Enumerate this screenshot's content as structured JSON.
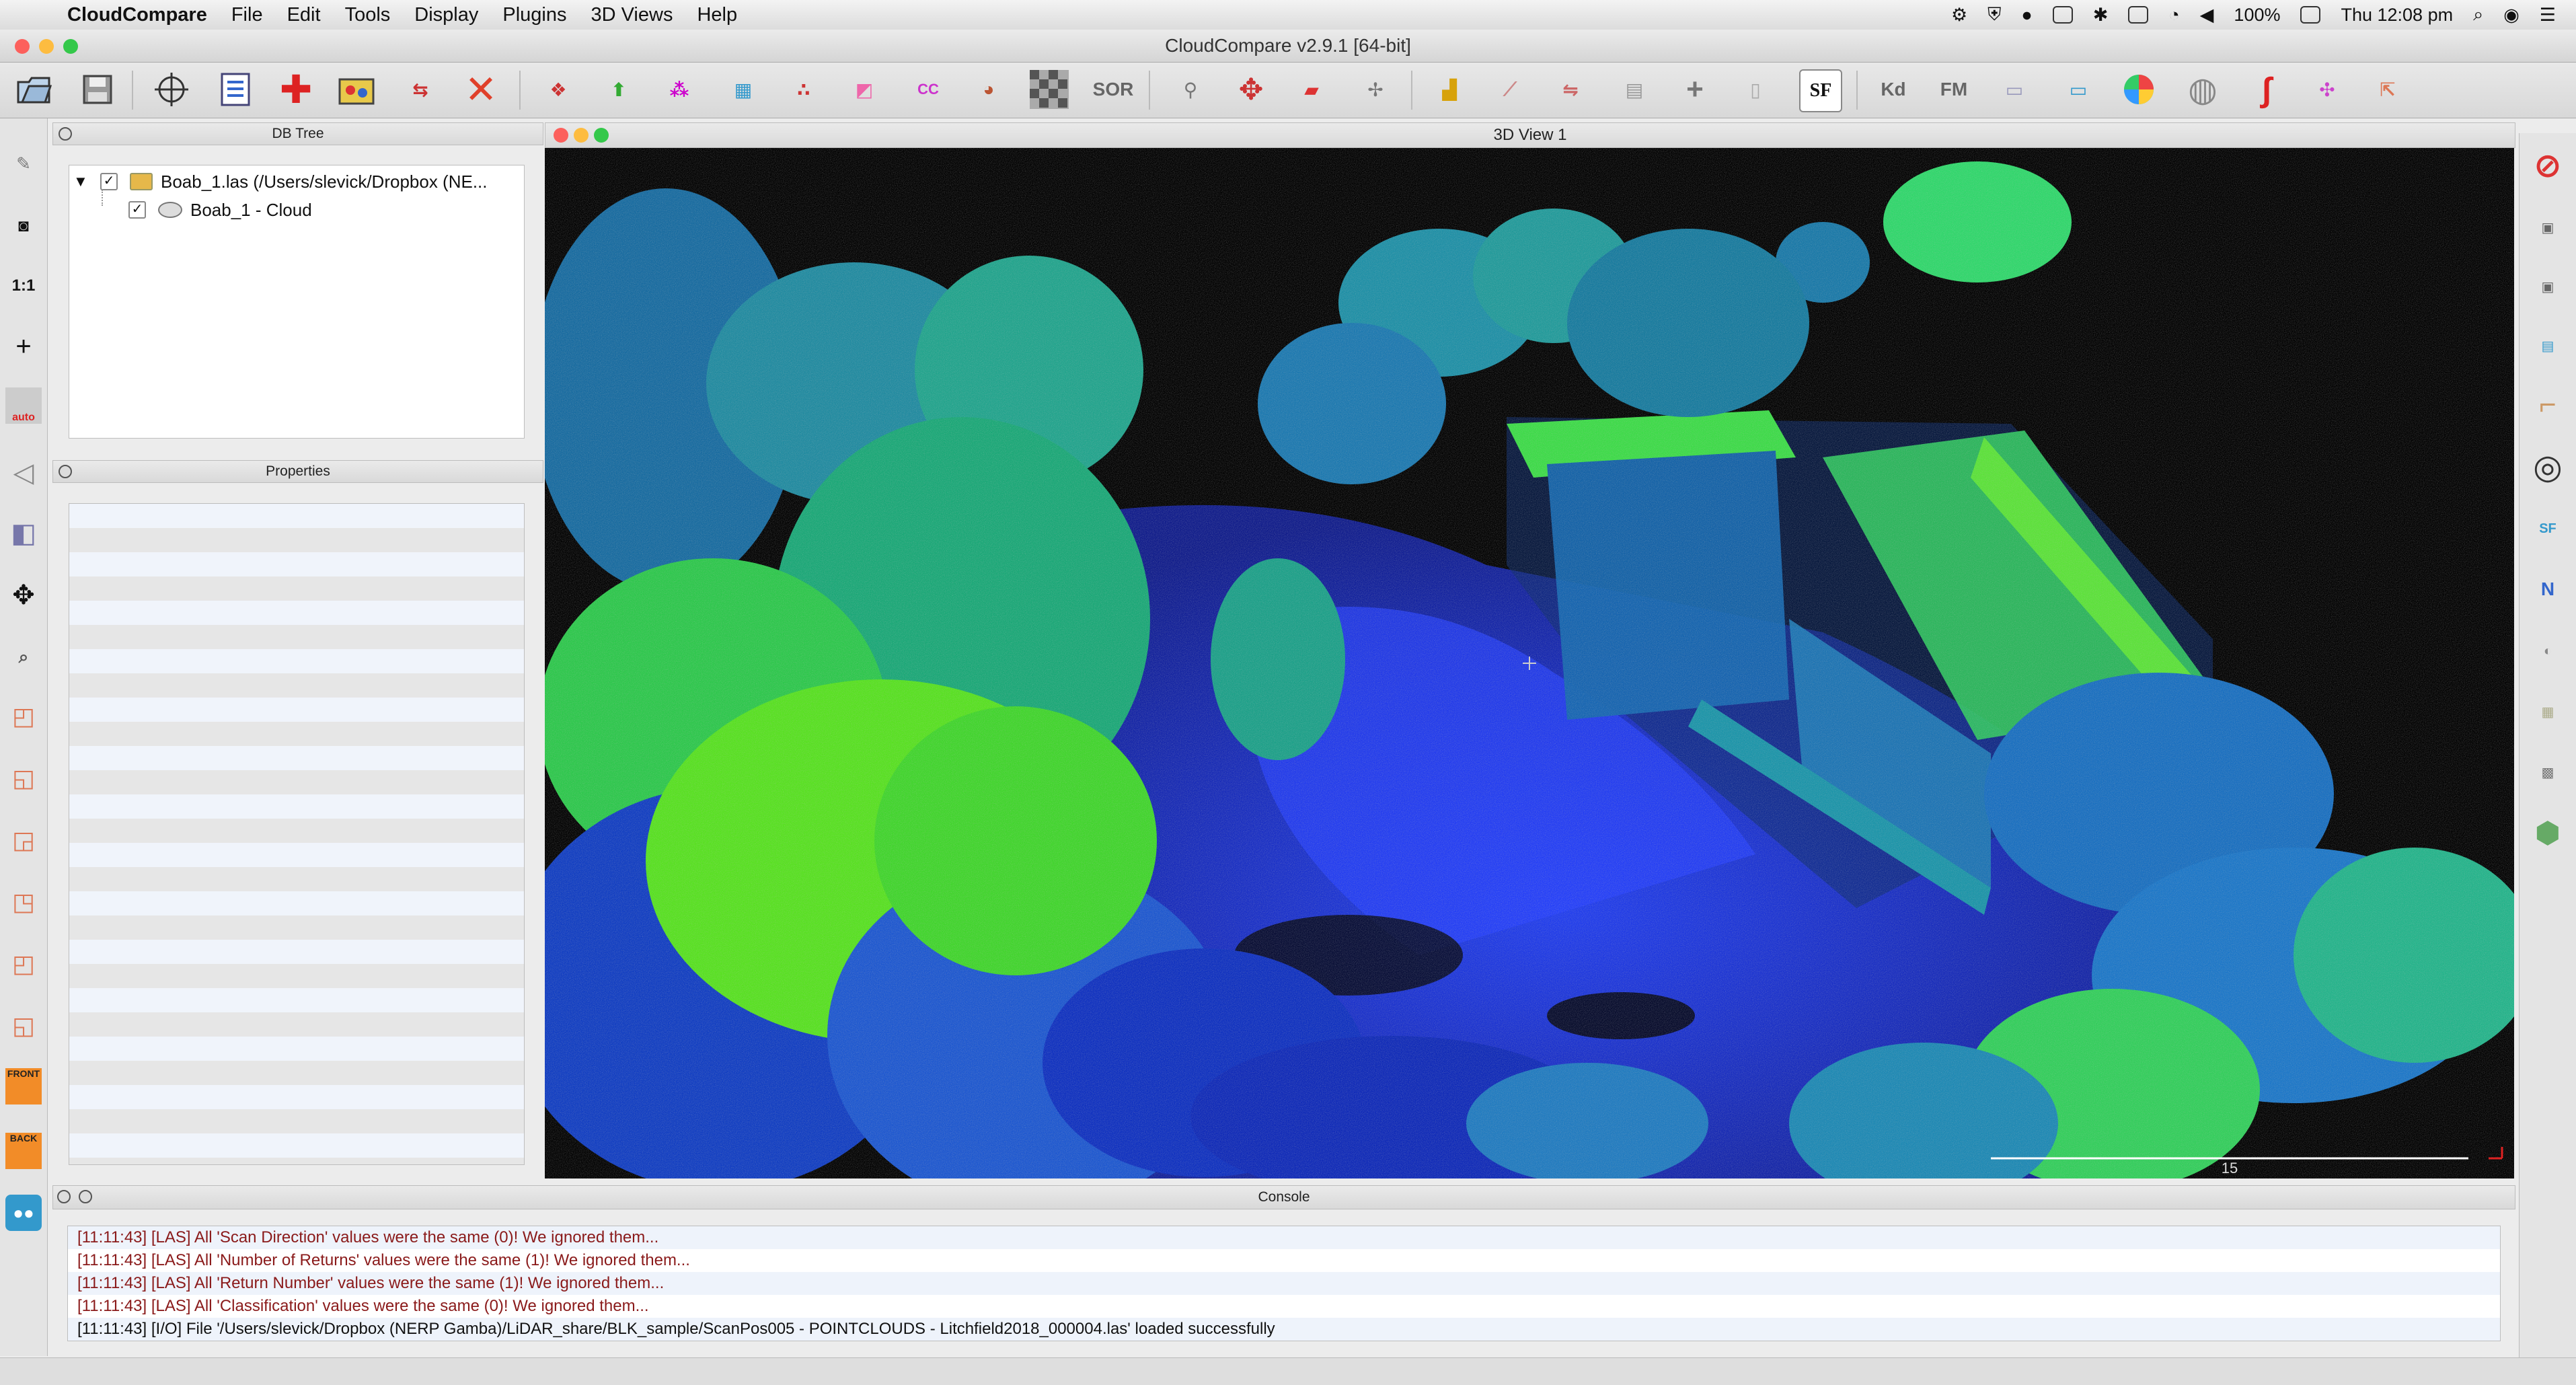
{
  "menubar": {
    "app_name": "CloudCompare",
    "items": [
      "File",
      "Edit",
      "Tools",
      "Display",
      "Plugins",
      "3D Views",
      "Help"
    ],
    "battery": "100%",
    "clock": "Thu 12:08 pm"
  },
  "window": {
    "title": "CloudCompare v2.9.1 [64-bit]"
  },
  "toolbar": {
    "sor_label": "SOR",
    "sf_label": "SF",
    "kd_label": "Kd",
    "fm_label": "FM",
    "cc_label": "CC"
  },
  "left_toolbar": {
    "scale_label": "1:1",
    "auto_label": "auto",
    "front_label": "FRONT",
    "back_label": "BACK"
  },
  "db_tree": {
    "header": "DB Tree",
    "root": {
      "label": "Boab_1.las (/Users/slevick/Dropbox (NE...",
      "checked": true
    },
    "child": {
      "label": "Boab_1 - Cloud",
      "checked": true
    }
  },
  "properties": {
    "header": "Properties"
  },
  "view3d": {
    "header": "3D View 1",
    "scale_value": "15",
    "colors": {
      "ground": "#1a2fc8",
      "mid": "#1e8ccc",
      "high": "#7cf21a",
      "background": "#000000"
    }
  },
  "right_toolbar": {
    "compass_label": "N",
    "sf_label": "SF"
  },
  "console": {
    "header": "Console",
    "lines": [
      {
        "text": "[11:11:43] [LAS] All 'Scan Direction' values were the same (0)! We ignored them...",
        "color": "#8a1a1a"
      },
      {
        "text": "[11:11:43] [LAS] All 'Number of Returns' values were the same (1)! We ignored them...",
        "color": "#8a1a1a"
      },
      {
        "text": "[11:11:43] [LAS] All 'Return Number' values were the same (1)! We ignored them...",
        "color": "#8a1a1a"
      },
      {
        "text": "[11:11:43] [LAS] All 'Classification' values were the same (0)! We ignored them...",
        "color": "#8a1a1a"
      },
      {
        "text": "[11:11:43] [I/O] File '/Users/slevick/Dropbox (NERP Gamba)/LiDAR_share/BLK_sample/ScanPos005 - POINTCLOUDS - Litchfield2018_000004.las' loaded successfully",
        "color": "#111111"
      }
    ]
  }
}
